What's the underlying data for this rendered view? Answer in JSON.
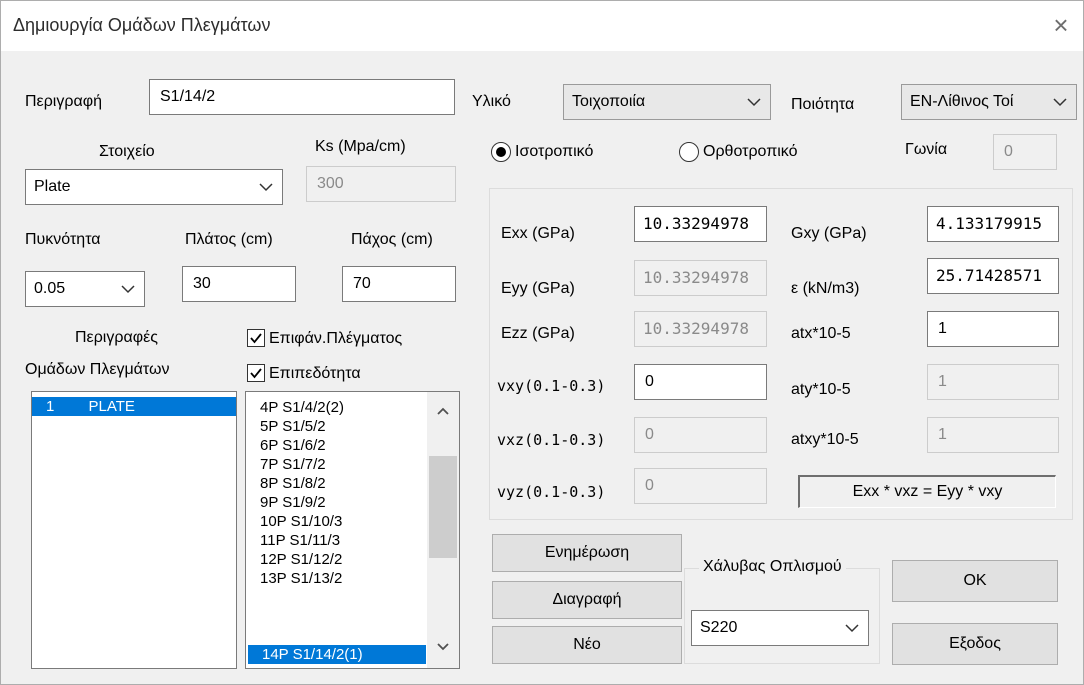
{
  "window": {
    "title": "Δημιουργία Ομάδων Πλεγμάτων",
    "close_glyph": "×"
  },
  "description": {
    "label": "Περιγραφή",
    "value": "S1/14/2"
  },
  "material": {
    "label": "Υλικό",
    "value": "Τοιχοποιία"
  },
  "quality": {
    "label": "Ποιότητα",
    "value": "EN-Λίθινος Τοί"
  },
  "element": {
    "label": "Στοιχείο",
    "value": "Plate"
  },
  "ks": {
    "label": "Ks (Mpa/cm)",
    "value": "300"
  },
  "isotropy": {
    "isotropic_label": "Ισοτροπικό",
    "orthotropic_label": "Ορθοτροπικό",
    "selected": "isotropic"
  },
  "angle": {
    "label": "Γωνία",
    "value": "0"
  },
  "density": {
    "label": "Πυκνότητα",
    "value": "0.05"
  },
  "width": {
    "label": "Πλάτος (cm)",
    "value": "30"
  },
  "thickness": {
    "label": "Πάχος (cm)",
    "value": "70"
  },
  "groups": {
    "label_line1": "Περιγραφές",
    "label_line2": "Ομάδων Πλεγμάτων",
    "items": [
      {
        "num": "1",
        "name": "PLATE",
        "selected": true
      }
    ]
  },
  "surface_checkbox": {
    "label": "Επιφάν.Πλέγματος",
    "checked": true
  },
  "plane_checkbox": {
    "label": "Επιπεδότητα",
    "checked": true
  },
  "mesh_list": {
    "items": [
      "4P S1/4/2(2)",
      "5P S1/5/2",
      "6P S1/6/2",
      "7P S1/7/2",
      "8P S1/8/2",
      "9P S1/9/2",
      "10P S1/10/3",
      "11P S1/11/3",
      "12P S1/12/2",
      "13P S1/13/2",
      "14P S1/14/2(1)"
    ],
    "selected": "14P S1/14/2(1)"
  },
  "props": {
    "exx": {
      "label": "Exx (GPa)",
      "value": "10.33294978"
    },
    "eyy": {
      "label": "Eyy (GPa)",
      "value": "10.33294978"
    },
    "ezz": {
      "label": "Ezz (GPa)",
      "value": "10.33294978"
    },
    "vxy": {
      "label": "vxy(0.1-0.3)",
      "value": "0"
    },
    "vxz": {
      "label": "vxz(0.1-0.3)",
      "value": "0"
    },
    "vyz": {
      "label": "vyz(0.1-0.3)",
      "value": "0"
    },
    "gxy": {
      "label": "Gxy (GPa)",
      "value": "4.133179915"
    },
    "eps": {
      "label": "ε (kN/m3)",
      "value": "25.71428571"
    },
    "atx": {
      "label": "atx*10-5",
      "value": "1"
    },
    "aty": {
      "label": "aty*10-5",
      "value": "1"
    },
    "atxy": {
      "label": "atxy*10-5",
      "value": "1"
    },
    "formula": "Exx * vxz = Eyy * vxy"
  },
  "buttons": {
    "update": "Ενημέρωση",
    "delete": "Διαγραφή",
    "new": "Νέο",
    "ok": "OK",
    "exit": "Εξοδος"
  },
  "steel": {
    "label": "Χάλυβας Οπλισμού",
    "value": "S220"
  }
}
